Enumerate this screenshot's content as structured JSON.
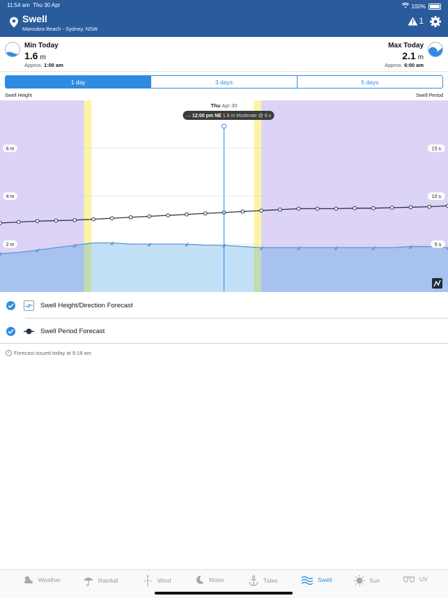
{
  "status": {
    "time": "11:54 am",
    "date": "Thu 30 Apr",
    "battery": "100%"
  },
  "header": {
    "title": "Swell",
    "location": "Maroubra Beach - Sydney, NSW",
    "alert_count": "1",
    "icons": {
      "location": "location-pin-icon",
      "alert": "warning-icon",
      "settings": "gear-icon"
    }
  },
  "min_today": {
    "label": "Min Today",
    "value": "1.6",
    "unit": "m",
    "approx_prefix": "Approx.",
    "time": "1:00 am"
  },
  "max_today": {
    "label": "Max Today",
    "value": "2.1",
    "unit": "m",
    "approx_prefix": "Approx.",
    "time": "6:00 am"
  },
  "tabs": [
    {
      "label": "1 day",
      "active": true
    },
    {
      "label": "3 days",
      "active": false
    },
    {
      "label": "5 days",
      "active": false
    }
  ],
  "chart_labels": {
    "left_title": "Swell Height",
    "right_title": "Swell Period"
  },
  "chart_data": {
    "type": "line",
    "day_label": "Thu",
    "date_label": "Apr 30",
    "tooltip": {
      "time": "12:00 pm",
      "direction": "NE",
      "height": "1.9 m",
      "description": "Moderate @ 8 s"
    },
    "y_left": {
      "ticks": [
        2,
        4,
        6
      ],
      "tick_labels": [
        "2 m",
        "4 m",
        "6 m"
      ],
      "range": [
        0,
        8
      ]
    },
    "y_right": {
      "ticks": [
        5,
        10,
        15
      ],
      "tick_labels": [
        "5 s",
        "10 s",
        "15 s"
      ],
      "range": [
        0,
        20
      ]
    },
    "x_hours": [
      0,
      1,
      2,
      3,
      4,
      5,
      6,
      7,
      8,
      9,
      10,
      11,
      12,
      13,
      14,
      15,
      16,
      17,
      18,
      19,
      20,
      21,
      22,
      23,
      24
    ],
    "series": [
      {
        "values": [
          1.6,
          1.65,
          1.75,
          1.85,
          1.95,
          2.05,
          2.05,
          2.0,
          2.0,
          2.0,
          2.0,
          1.95,
          1.95,
          1.9,
          1.85,
          1.85,
          1.85,
          1.85,
          1.85,
          1.85,
          1.85,
          1.85,
          1.9,
          1.9,
          1.85
        ]
      },
      {
        "values": [
          7.2,
          7.3,
          7.4,
          7.45,
          7.5,
          7.6,
          7.7,
          7.8,
          7.9,
          8.0,
          8.1,
          8.2,
          8.3,
          8.4,
          8.5,
          8.6,
          8.7,
          8.7,
          8.7,
          8.75,
          8.75,
          8.8,
          8.85,
          8.9,
          9.0
        ]
      }
    ],
    "daylight": {
      "first_light": 4.5,
      "sunrise": 4.9,
      "sunset": 13.6,
      "last_light": 14.0
    },
    "colors": {
      "night": "#dcd3f6",
      "twilight": "#fdf3a6",
      "day": "#ffffff",
      "height_fill_night": "#a7c2ef",
      "height_fill_day": "#c2e1f7",
      "height_fill_twilight": "#c2dbb0",
      "height_line": "#5b95d6",
      "period_line": "#233447",
      "marker": "#2f8be0"
    }
  },
  "legend": [
    {
      "label": "Swell Height/Direction Forecast",
      "checked": true
    },
    {
      "label": "Swell Period Forecast",
      "checked": true
    }
  ],
  "footer_note": "Forecast issued today at 9:18 am",
  "nav": [
    {
      "label": "Weather",
      "icon": "weather-icon",
      "active": false
    },
    {
      "label": "Rainfall",
      "icon": "umbrella-icon",
      "active": false
    },
    {
      "label": "Wind",
      "icon": "wind-turbine-icon",
      "active": false
    },
    {
      "label": "Moon",
      "icon": "moon-icon",
      "active": false
    },
    {
      "label": "Tides",
      "icon": "anchor-icon",
      "active": false
    },
    {
      "label": "Swell",
      "icon": "wave-icon",
      "active": true
    },
    {
      "label": "Sun",
      "icon": "sun-icon",
      "active": false
    },
    {
      "label": "UV",
      "icon": "sunglasses-icon",
      "active": false
    }
  ]
}
